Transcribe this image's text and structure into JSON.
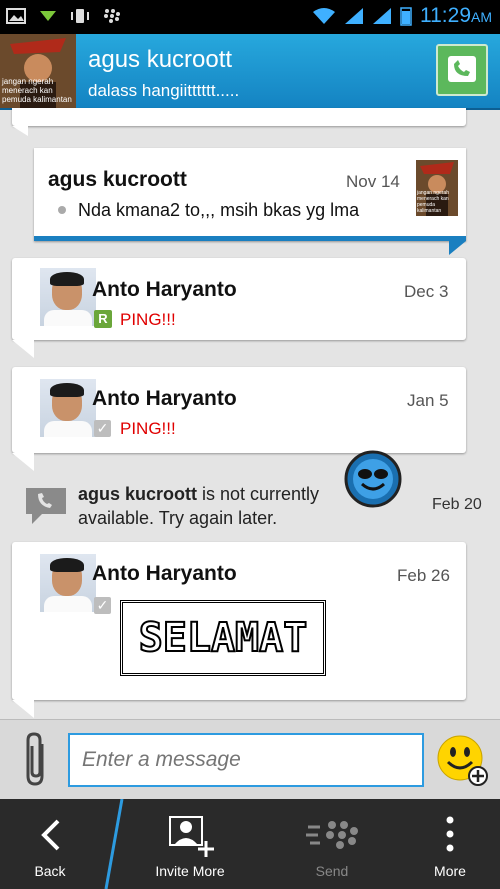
{
  "status_bar": {
    "time": "11:29",
    "ampm": "AM"
  },
  "header": {
    "contact_name": "agus kucroott",
    "status_message": "dalass hangiitttttt.....",
    "avatar_caption": "jangan ngerah menerach kan pemuda kalimantan"
  },
  "messages": [
    {
      "sender": "agus kucroott",
      "date": "Nov 14",
      "text": "Nda kmana2 to,,, msih bkas yg lma",
      "avatar_caption": "jangan ngerah menerach kan pemuda kalimantan"
    },
    {
      "sender": "Anto Haryanto",
      "date": "Dec 3",
      "text": "PING!!!",
      "badge": "R"
    },
    {
      "sender": "Anto Haryanto",
      "date": "Jan 5",
      "text": "PING!!!",
      "badge": "✓"
    },
    {
      "sender": "Anto Haryanto",
      "date": "Feb 26",
      "text": "SELAMAT",
      "badge": "✓"
    }
  ],
  "system_notice": {
    "name": "agus kucroott",
    "line1_rest": " is not currently",
    "line2": "available. Try again later.",
    "date": "Feb 20"
  },
  "composer": {
    "placeholder": "Enter a message"
  },
  "toolbar": {
    "back": "Back",
    "invite_more": "Invite More",
    "send": "Send",
    "more": "More"
  },
  "colors": {
    "accent": "#2d9be0",
    "header": "#1a95d2",
    "ping": "#e00000",
    "call": "#5cb85c"
  }
}
